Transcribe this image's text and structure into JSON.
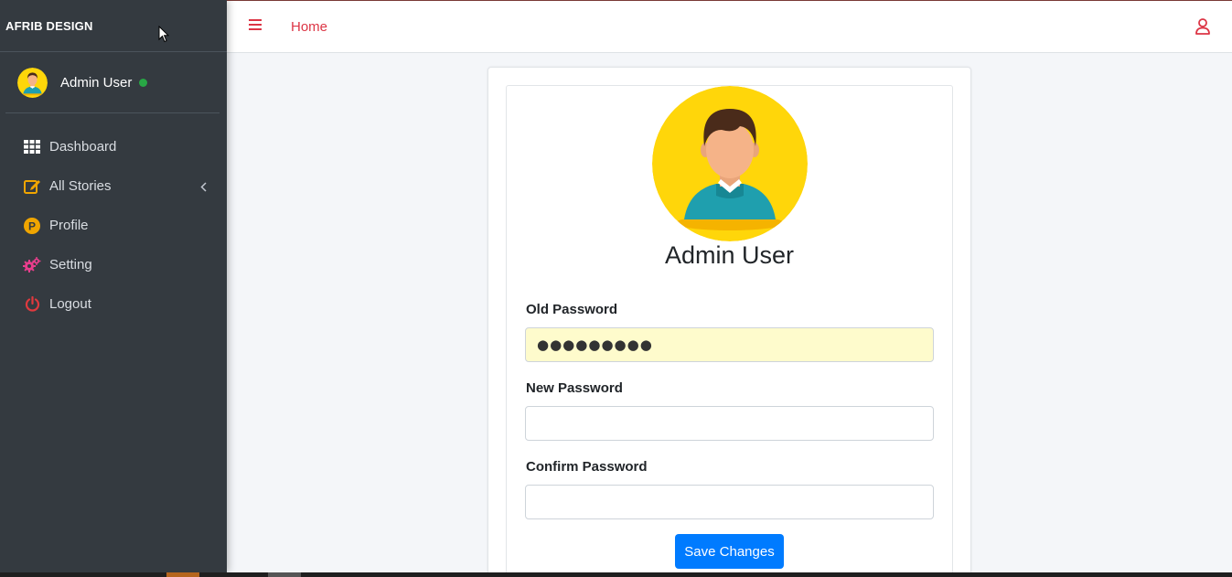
{
  "brand": "AFRIB DESIGN",
  "user": {
    "name": "Admin User"
  },
  "sidebar": {
    "items": [
      {
        "label": "Dashboard",
        "icon": "grid-icon"
      },
      {
        "label": "All Stories",
        "icon": "edit-icon"
      },
      {
        "label": "Profile",
        "icon": "profile-p-icon"
      },
      {
        "label": "Setting",
        "icon": "gears-icon"
      },
      {
        "label": "Logout",
        "icon": "power-icon"
      }
    ]
  },
  "topbar": {
    "home": "Home"
  },
  "profile": {
    "name": "Admin User"
  },
  "form": {
    "old_password": {
      "label": "Old Password",
      "value": "●●●●●●●●●"
    },
    "new_password": {
      "label": "New Password",
      "value": ""
    },
    "confirm_password": {
      "label": "Confirm Password",
      "value": ""
    },
    "submit": "Save Changes"
  },
  "colors": {
    "sidebar_bg": "#343a40",
    "accent_red": "#dc3545",
    "primary_blue": "#007bff",
    "online_green": "#28a745",
    "avatar_yellow": "#ffd60a",
    "autofill_bg": "#fefbcc"
  }
}
